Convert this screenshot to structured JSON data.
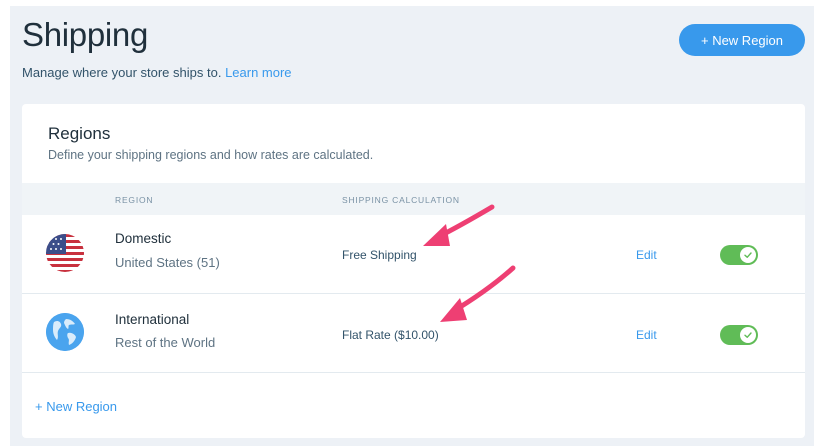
{
  "header": {
    "title": "Shipping",
    "subtitle": "Manage where your store ships to.",
    "learn_more": "Learn more",
    "new_region_button": "+ New Region"
  },
  "regions_card": {
    "title": "Regions",
    "description": "Define your shipping regions and how rates are calculated.",
    "columns": [
      "REGION",
      "SHIPPING CALCULATION"
    ],
    "rows": [
      {
        "icon": "us-flag-icon",
        "name": "Domestic",
        "detail": "United States (51)",
        "calculation": "Free Shipping",
        "edit_label": "Edit",
        "enabled": true
      },
      {
        "icon": "globe-icon",
        "name": "International",
        "detail": "Rest of the World",
        "calculation": "Flat Rate  ($10.00)",
        "edit_label": "Edit",
        "enabled": true
      }
    ],
    "add_region_link": "+ New Region"
  },
  "colors": {
    "accent": "#3899ec",
    "toggle_on": "#60bc57",
    "annotation_arrow": "#ee3f73",
    "page_bg": "#edf1f6"
  }
}
